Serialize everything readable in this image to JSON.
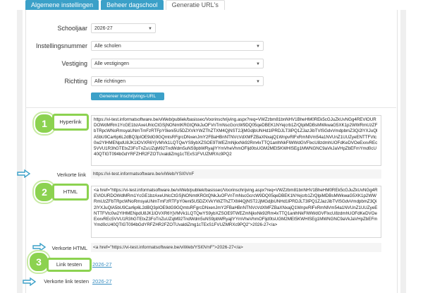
{
  "tabs": [
    {
      "label": "Algemene instellingen"
    },
    {
      "label": "Beheer dagschool"
    },
    {
      "label": "Generatie URL's"
    }
  ],
  "form": {
    "schooljaar": {
      "label": "Schooljaar",
      "value": "2026-27"
    },
    "instellingsnummer": {
      "label": "Instellingsnummer",
      "value": "Alle scholen"
    },
    "vestiging": {
      "label": "Vestiging",
      "value": "Alle vestigingen"
    },
    "richting": {
      "label": "Richting",
      "value": "Alle richtingen"
    },
    "generate_button": "Genereer Inschrijvings-URL"
  },
  "results": {
    "hyperlink_label": "Hyperlink",
    "hyperlink_value": "https://vi-test.informatsoftware.be/viWeb/publiek/basissec/Voorinschrijving.aspx?req=VWZzbm81bnNHV1BheHM0REk5cGJuZkUvNGg4REVlOURDOWdMRm1YcGE1bzAxeUhlcCtGSjNONmtKRGtQNkJuOFVnTmNscGcrcW9DQ05qeDBEK1NYejcrb1ZrQlpiMDBsMWkwaG5XK1p2WWRmUzZFbTRpcWNoRmsyaUNmTmFzRTFpY0ieni5U5DZXVkYWZThZTXM4QjNST2JjMGdjbUNHd1lPRDJLT3lPQ1ZJazJibTVlSGdvVmdpbmZ3Qi2lYXJuQlA5bU9Car6p6L2dBQ3pIOE9dG9GQmtsRFgrcDNxenJmY2FBaHBnNTNVcVdXMFZBaXNxajQ1WnpvRlFxRmNlVm54a1NVUnZ1UUZyeENTTFVtc0w2YlHMENpdU8JK1lOVXR6YjVMVk1LQTQwYS9ybXZSOE9TWEZmNjkxNk92Rm4xTTQ1anlhNkFlWWdGVFlxcU8zdmhUOFdKeDVOeExxvREc5VVU1R3hGTEtxZ3FoTnZuUZqM92TndWdm5uNS9pbWRyajlYYmVheVhmOFljd0tsUGM2MEt5KWHlSEg1MWNGNC9aVkJaVHpZbEFmYmd0cU40QTlGT094bGdYRFZHR2FZOTUvaldiZmg1cTExS1FVUZMRXc9PQ2",
    "verkorte_link_label": "Verkorte link",
    "verkorte_link_value": "https://vi-test.informatsoftware.be/viWeb/YSI0VnF",
    "html_label": "HTML",
    "html_value": "<a href=\"https://vi-test.informatsoftware.be/viWeb/publiek/basissec/Voorinschrijving.aspx?req=VWZzbm81bnNHV1BheHM0REk5cGJuZkUvNGg4REVlOURDOWdMRm1YcGE1bzAxeUhlcCtGSjNONmtKRGtQNkJuOFVnTmNscGcrcW9DQ05qeDBEK1NYejcrb1ZrQlpiMDBsMWkwaG5XK1p2WWRmUzZFbTRpcWNoRmsyaUNmTmFzRTFpY0ieni5U5DZXVkYWZThZTXM4QjNST2JjMGdjbUNHd1lPRDJLT3lPQ1ZJazJibTVlSGdvVmdpbmZ3Qi2lYXJuQlA5bU9Car6p6L2dBQ3pIOE9dG9GQmtsRFgrcDNxenJmY2FBaHBnNTNVcVdXMFZBaXNxajQ1WnpvRlFxRmNlVm54a1NVUnZ1UUZyeENTTFVtc0w2YlHMENpdU8JK1lOVXR6YjVMVk1LQTQwYS9ybXZSOE9TWEZmNjkxNk92Rm4xTTQ1anlhNkFlWWdGVFlxcU8zdmhUOFdKeDVOeExxvREc5VVU1R3hGTEtxZ3FoTnZuUZqM92TndWdm5uNS9pbWRyajlYYmVheVhmOFljd0tsUGM2MEt5KWHlSEg1MWNGNC9aVkJaVHpZbEFmYmd0cU40QTlGT094bGdYRFZHR2FZOTUvaldiZmg1cTExS1FVUZMRXc9PQ2\">2026-27</a>",
    "verkorte_html_label": "Verkorte HTML",
    "verkorte_html_value": "<a href=\"https://vi-test.informatsoftware.be/viWeb/YSI0VnF\">2026-27</a>",
    "link_testen_label": "Link testen",
    "link_testen_value": "2026-27",
    "verkorte_link_testen_label": "Verkorte link testen",
    "verkorte_link_testen_value": "2026-27"
  },
  "badges": [
    "1",
    "2",
    "3"
  ],
  "colors": {
    "accent": "#3ba0c8",
    "highlight": "#8cd250",
    "link": "#3a8fc2"
  },
  "icons": [
    "caret-down-icon",
    "arrow-right-icon"
  ]
}
